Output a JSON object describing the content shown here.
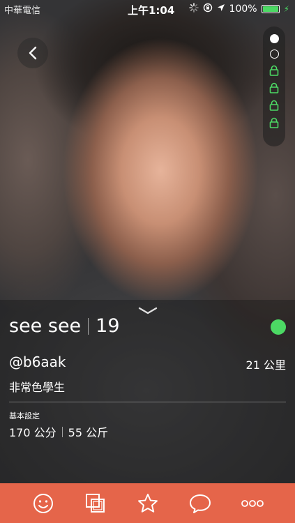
{
  "status_bar": {
    "carrier": "中華電信",
    "time": "上午1:04",
    "battery_percent": "100%",
    "icons": [
      "activity-spinner-icon",
      "orientation-lock-icon",
      "location-arrow-icon",
      "battery-icon",
      "charging-bolt-icon"
    ],
    "battery_color": "#4cd964"
  },
  "navigation": {
    "back_icon": "chevron-left-icon"
  },
  "photo_pager": {
    "pages": [
      "current",
      "available",
      "locked",
      "locked",
      "locked",
      "locked"
    ],
    "locked_color": "#4cd964"
  },
  "profile": {
    "name": "see see",
    "age": "19",
    "online": true,
    "online_color": "#4cd964",
    "username": "@b6aak",
    "distance": "21 公里",
    "tagline": "非常色學生",
    "basic_settings_label": "基本設定",
    "height": "170 公分",
    "weight": "55 公斤"
  },
  "tab_bar": {
    "background": "#e5654a",
    "tabs": [
      {
        "icon": "smiley-icon"
      },
      {
        "icon": "photos-stack-icon"
      },
      {
        "icon": "star-icon"
      },
      {
        "icon": "chat-bubble-icon"
      },
      {
        "icon": "more-dots-icon"
      }
    ]
  }
}
